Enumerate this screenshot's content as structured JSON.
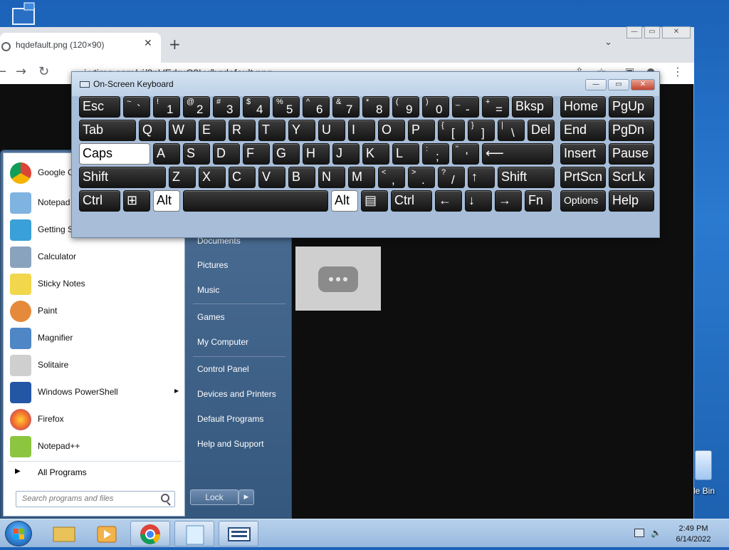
{
  "desktop": {
    "recycle_bin_label": "le Bin"
  },
  "browser": {
    "tab_title": "hqdefault.png (120×90)",
    "tab_close": "✕",
    "new_tab": "+",
    "tab_menu": "⌄",
    "url": "i.ytimg.com/vi/3nVEdruC3Lv/hqdefault.png"
  },
  "start_menu": {
    "programs": [
      {
        "label": "Google C",
        "icon_color": "#db4437"
      },
      {
        "label": "Notepad",
        "icon_color": "#7fb3e0"
      },
      {
        "label": "Getting St",
        "icon_color": "#3aa0d8"
      },
      {
        "label": "Calculator",
        "icon_color": "#8aa3bd"
      },
      {
        "label": "Sticky Notes",
        "icon_color": "#f2d64b"
      },
      {
        "label": "Paint",
        "icon_color": "#e48a3a"
      },
      {
        "label": "Magnifier",
        "icon_color": "#4f86c6"
      },
      {
        "label": "Solitaire",
        "icon_color": "#cfcfcf"
      },
      {
        "label": "Windows PowerShell",
        "icon_color": "#2456a6",
        "has_submenu": true
      },
      {
        "label": "Firefox",
        "icon_color": "#f06a2a"
      },
      {
        "label": "Notepad++",
        "icon_color": "#8cc640"
      }
    ],
    "all_programs": "All Programs",
    "search_placeholder": "Search programs and files",
    "right_items": [
      "Documents",
      "Pictures",
      "Music",
      "Games",
      "My Computer",
      "Control Panel",
      "Devices and Printers",
      "Default Programs",
      "Help and Support"
    ],
    "lock_label": "Lock",
    "lock_arrow": "▶"
  },
  "osk": {
    "title": "On-Screen Keyboard",
    "minimize": "—",
    "restore": "▭",
    "close": "✕",
    "rows": [
      [
        {
          "label": "Esc"
        },
        {
          "top": "~",
          "bottom": "`"
        },
        {
          "top": "!",
          "bottom": "1"
        },
        {
          "top": "@",
          "bottom": "2"
        },
        {
          "top": "#",
          "bottom": "3"
        },
        {
          "top": "$",
          "bottom": "4"
        },
        {
          "top": "%",
          "bottom": "5"
        },
        {
          "top": "^",
          "bottom": "6"
        },
        {
          "top": "&",
          "bottom": "7"
        },
        {
          "top": "*",
          "bottom": "8"
        },
        {
          "top": "(",
          "bottom": "9"
        },
        {
          "top": ")",
          "bottom": "0"
        },
        {
          "top": "_",
          "bottom": "-"
        },
        {
          "top": "+",
          "bottom": "="
        },
        {
          "label": "Bksp"
        },
        {
          "label": "Home"
        },
        {
          "label": "PgUp"
        }
      ],
      [
        {
          "label": "Tab"
        },
        {
          "label": "Q"
        },
        {
          "label": "W"
        },
        {
          "label": "E"
        },
        {
          "label": "R"
        },
        {
          "label": "T"
        },
        {
          "label": "Y"
        },
        {
          "label": "U"
        },
        {
          "label": "I"
        },
        {
          "label": "O"
        },
        {
          "label": "P"
        },
        {
          "top": "{",
          "bottom": "["
        },
        {
          "top": "}",
          "bottom": "]"
        },
        {
          "top": "|",
          "bottom": "\\"
        },
        {
          "label": "Del"
        },
        {
          "label": "End"
        },
        {
          "label": "PgDn"
        }
      ],
      [
        {
          "label": "Caps",
          "active": true
        },
        {
          "label": "A"
        },
        {
          "label": "S"
        },
        {
          "label": "D"
        },
        {
          "label": "F"
        },
        {
          "label": "G"
        },
        {
          "label": "H"
        },
        {
          "label": "J"
        },
        {
          "label": "K"
        },
        {
          "label": "L"
        },
        {
          "top": ":",
          "bottom": ";"
        },
        {
          "top": "\"",
          "bottom": "'"
        },
        {
          "label": "⟵"
        },
        {
          "label": "Insert"
        },
        {
          "label": "Pause"
        }
      ],
      [
        {
          "label": "Shift"
        },
        {
          "label": "Z"
        },
        {
          "label": "X"
        },
        {
          "label": "C"
        },
        {
          "label": "V"
        },
        {
          "label": "B"
        },
        {
          "label": "N"
        },
        {
          "label": "M"
        },
        {
          "top": "<",
          "bottom": ","
        },
        {
          "top": ">",
          "bottom": "."
        },
        {
          "top": "?",
          "bottom": "/"
        },
        {
          "label": "↑"
        },
        {
          "label": "Shift"
        },
        {
          "label": "PrtScn"
        },
        {
          "label": "ScrLk"
        }
      ],
      [
        {
          "label": "Ctrl"
        },
        {
          "label": "⊞"
        },
        {
          "label": "Alt",
          "active": true
        },
        {
          "label": ""
        },
        {
          "label": "Alt",
          "active": true
        },
        {
          "label": "▤"
        },
        {
          "label": "Ctrl"
        },
        {
          "label": "←"
        },
        {
          "label": "↓"
        },
        {
          "label": "→"
        },
        {
          "label": "Fn"
        },
        {
          "label": "Options"
        },
        {
          "label": "Help"
        }
      ]
    ]
  },
  "taskbar": {
    "time": "2:49 PM",
    "date": "6/14/2022"
  }
}
